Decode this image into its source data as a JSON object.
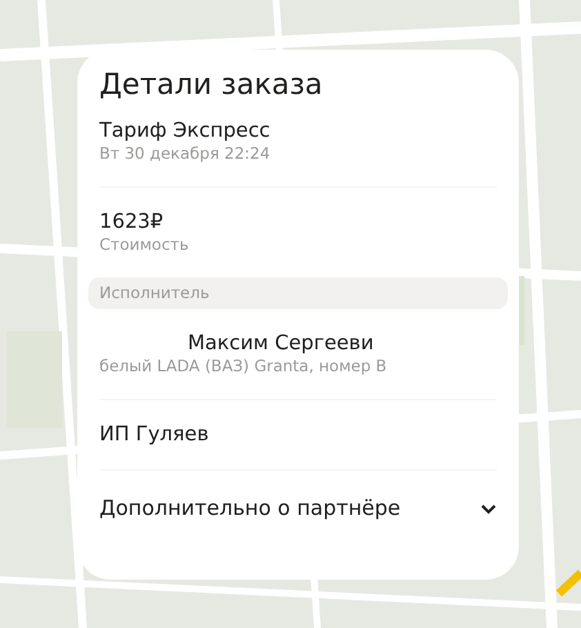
{
  "dialog": {
    "title": "Детали заказа",
    "order": {
      "tariff": "Тариф Экспресс",
      "date": "Вт 30 декабря 22:24"
    },
    "price": {
      "amount": "1623₽",
      "label": "Стоимость"
    },
    "section_header": "Исполнитель",
    "driver": {
      "name": "Максим Сергееви",
      "car": "белый LADA (ВАЗ) Granta, номер В"
    },
    "partner": "ИП Гуляев",
    "more": {
      "label": "Дополнительно о партнёре",
      "expanded": false
    }
  }
}
